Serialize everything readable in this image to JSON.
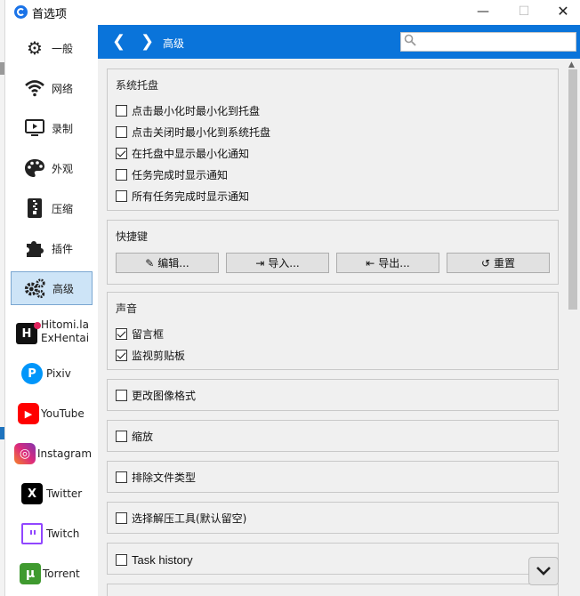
{
  "window": {
    "title": "首选项",
    "minimize_glyph": "—",
    "maximize_glyph": "☐",
    "close_glyph": "✕"
  },
  "sidebar": {
    "items": [
      {
        "label": "一般",
        "icon": "gear-icon"
      },
      {
        "label": "网络",
        "icon": "wifi-icon"
      },
      {
        "label": "录制",
        "icon": "screen-record-icon"
      },
      {
        "label": "外观",
        "icon": "palette-icon"
      },
      {
        "label": "压缩",
        "icon": "zip-icon"
      },
      {
        "label": "插件",
        "icon": "puzzle-icon"
      },
      {
        "label": "高级",
        "icon": "gears-icon",
        "active": true
      }
    ],
    "sites": [
      {
        "label_line1": "Hitomi.la",
        "label_line2": "ExHentai",
        "glyph": "H"
      },
      {
        "label": "Pixiv",
        "glyph": "P",
        "color": "#0096fa"
      },
      {
        "label": "YouTube",
        "glyph": "▶",
        "color": "#ff0000"
      },
      {
        "label": "Instagram",
        "glyph": "◎",
        "color": "#c13584"
      },
      {
        "label": "Twitter",
        "glyph": "X",
        "color": "#000000"
      },
      {
        "label": "Twitch",
        "glyph": "▭",
        "color": "#9146ff"
      },
      {
        "label": "Torrent",
        "glyph": "µ",
        "color": "#3f9a2f"
      }
    ]
  },
  "header": {
    "back_glyph": "❮",
    "forward_glyph": "❯",
    "title": "高级",
    "search_placeholder": ""
  },
  "tray_group": {
    "title": "系统托盘",
    "options": [
      {
        "label": "点击最小化时最小化到托盘",
        "checked": false
      },
      {
        "label": "点击关闭时最小化到系统托盘",
        "checked": false
      },
      {
        "label": "在托盘中显示最小化通知",
        "checked": true
      },
      {
        "label": "任务完成时显示通知",
        "checked": false
      },
      {
        "label": "所有任务完成时显示通知",
        "checked": false
      }
    ]
  },
  "shortcut_group": {
    "title": "快捷键",
    "buttons": [
      {
        "label": "编辑...",
        "icon": "pencil-icon",
        "glyph": "✎"
      },
      {
        "label": "导入...",
        "icon": "import-icon",
        "glyph": "⇥"
      },
      {
        "label": "导出...",
        "icon": "export-icon",
        "glyph": "⇤"
      },
      {
        "label": "重置",
        "icon": "reset-icon",
        "glyph": "↺"
      }
    ]
  },
  "sound_group": {
    "title": "声音",
    "options": [
      {
        "label": "留言框",
        "checked": true
      },
      {
        "label": "监视剪贴板",
        "checked": true
      }
    ]
  },
  "single_options": [
    {
      "label": "更改图像格式",
      "checked": false
    },
    {
      "label": "缩放",
      "checked": false
    },
    {
      "label": "排除文件类型",
      "checked": false
    },
    {
      "label": "选择解压工具(默认留空)",
      "checked": false
    },
    {
      "label": "Task history",
      "checked": false
    }
  ],
  "colors": {
    "accent": "#0a74da",
    "active_nav_bg": "#cde4f7",
    "panel_bg": "#f0f0f0"
  }
}
